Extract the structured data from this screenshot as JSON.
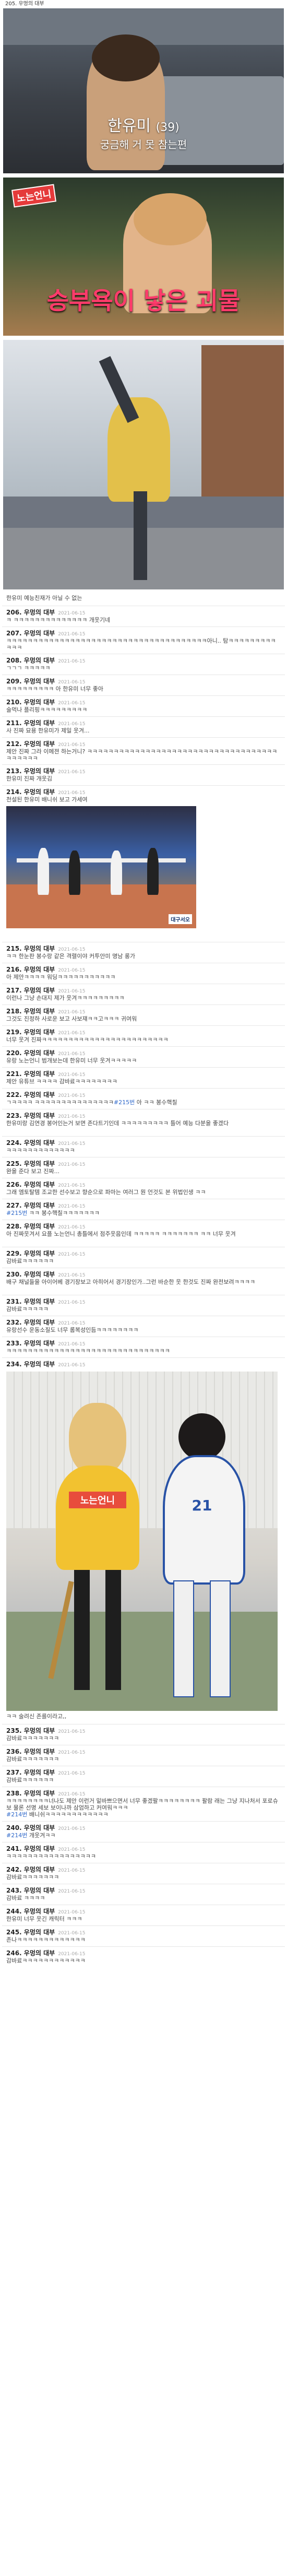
{
  "intro": "205. 우멍의 대부",
  "photo1": {
    "name": "한유미",
    "age": "(39)",
    "subtitle": "궁금해 거 못 참는편"
  },
  "photo2": {
    "logo": "노는언니",
    "caption": "승부욕이 낳은 괴물"
  },
  "under_text": "한유미 예능친재가 아닐 수 없는",
  "comments_a": [
    {
      "num": "206.",
      "author": "우멍의 대부",
      "date": "2021-06-15",
      "text": "ㅋ ㅋㅋㅋㅋㅋㅋㅋㅋㅋㅋㅋㅋㅋㅋ 개웃기네"
    },
    {
      "num": "207.",
      "author": "우멍의 대부",
      "date": "2021-06-15",
      "text": "ㅋㅋㅋㅋㅋㅋㅋㅋㅋㅋㅋㅋㅋㅋㅋㅋㅋㅋㅋㅋㅋㅋㅋㅋㅋㅋㅋㅋㅋㅋㅋㅋㅋㅋㅋㅋㅋㅋ아니.. 탐ㅋㅋㅋㅋㅋㅋㅋㅋㅋㅋㅋㅋ"
    },
    {
      "num": "208.",
      "author": "우멍의 대부",
      "date": "2021-06-15",
      "text": "ㄱㄱㄱ ㅋㅋㅋㅋㅋ"
    },
    {
      "num": "209.",
      "author": "우멍의 대부",
      "date": "2021-06-15",
      "text": "ㅋㅋㅋㅋㅋㅋㅋㅋㅋ 아 한유미 너무 좋아"
    },
    {
      "num": "210.",
      "author": "우멍의 대부",
      "date": "2021-06-15",
      "text": "술먹나 플리핑ㅋㅋㅋㅋㅋㅋㅋㅋㅋ"
    },
    {
      "num": "211.",
      "author": "우멍의 대부",
      "date": "2021-06-15",
      "text": "사 진짜 묘용 한유미가 제일 웃겨..."
    },
    {
      "num": "212.",
      "author": "우멍의 대부",
      "date": "2021-06-15",
      "text": "제안 진짜 그라 이메젼 하는거니? ㅋㅋㅋㅋㅋㅋㅋㅋㅋㅋㅋㅋㅋㅋㅋㅋㅋㅋㅋㅋㅋㅋㅋㅋㅋㅋㅋㅋㅋㅋㅋㅋㅋㅋㅋㅋㅋㅋㅋㅋㅋㅋ"
    },
    {
      "num": "213.",
      "author": "우멍의 대부",
      "date": "2021-06-15",
      "text": "한유미 진짜 개웃김"
    }
  ],
  "comment_214": {
    "num": "214.",
    "author": "우멍의 대부",
    "date": "2021-06-15",
    "text": "천설된 한유미 배니쉬 보고 가세여"
  },
  "photo4": {
    "banner": "대구서오"
  },
  "comments_b": [
    {
      "num": "215.",
      "author": "우멍의 대부",
      "date": "2021-06-15",
      "text": "ㅋㅋ 한눈판 봉수랑 같은 격렬이야 커투안미 명남 롱가"
    },
    {
      "num": "216.",
      "author": "우멍의 대부",
      "date": "2021-06-15",
      "text": "아 제안ㅋㅋㅋㅋ 워딩ㅋㅋㅋㅋㅋㅋㅋㅋㅋㅋㅋ"
    },
    {
      "num": "217.",
      "author": "우멍의 대부",
      "date": "2021-06-15",
      "text": "이런나 그냥 손대지 제가 웃겨ㅋㅋㅋㅋㅋㅋㅋㅋㅋ"
    },
    {
      "num": "218.",
      "author": "우멍의 대부",
      "date": "2021-06-15",
      "text": "그것도 진정하 사로운 보고 사보쟤ㅋㅋ고ㅋㅋㅋ 귀여워"
    },
    {
      "num": "219.",
      "author": "우멍의 대부",
      "date": "2021-06-15",
      "text": "너무 웃겨 진짜ㅋㅋㅋㅋㅋㅋㅋㅋㅋㅋㅋㅋㅋㅋㅋㅋㅋㅋㅋㅋㅋㅋㅋㅋ"
    },
    {
      "num": "220.",
      "author": "우멍의 대부",
      "date": "2021-06-15",
      "text": "유랑 노는언니 범개보는데 한유미 너무 웃겨ㅋㅋㅋㅋㅋ"
    },
    {
      "num": "221.",
      "author": "우멍의 대부",
      "date": "2021-06-15",
      "text": "제안 유튜브 ㅋㅋㅋㅋ 감바료ㅋㅋㅋㅋㅋㅋㅋㅋ"
    }
  ],
  "comment_222": {
    "num": "222.",
    "author": "우멍의 대부",
    "date": "2021-06-15",
    "prefix": "ㄱㅋㅋㅋㅋ ㅋㅋㅋㅋㅋㅋㅋㅋㅋㅋㅋㅋㅋㅋㅋ",
    "link": "#215번",
    "suffix": " 아 ㅋㅋ 봉수핵칠"
  },
  "comment_223": {
    "num": "223.",
    "author": "우멍의 대부",
    "date": "2021-06-15",
    "text": "한유미랑 김연경 봉어인는거 보면 존다트기인데 ㅋㅋㅋㅋㅋㅋㅋㅋㅋ 틀어 예능 다분을 좋겠다"
  },
  "comments_c": [
    {
      "num": "224.",
      "author": "우멍의 대부",
      "date": "2021-06-15",
      "text": "ㅋㅋㅋㅋㅋㅋㅋㅋㅋㅋㅋㅋㅋ"
    },
    {
      "num": "225.",
      "author": "우멍의 대부",
      "date": "2021-06-15",
      "text": "완을 준다 보고 진짜..."
    },
    {
      "num": "226.",
      "author": "우멍의 대부",
      "date": "2021-06-15",
      "text": "그래 엠토탈템 조교한 선수보고 향순으로 파마는 여러그 뭔 언것도 본 위법인생 ㅋㅋ"
    }
  ],
  "comment_227": {
    "num": "227.",
    "author": "우멍의 대부",
    "date": "2021-06-15",
    "link": "#215번",
    "suffix": " ㅋㅋ 봉수핵칠ㅋㅋㅋㅋㅋㅋㅋ"
  },
  "comment_228": {
    "num": "228.",
    "author": "우멍의 대부",
    "date": "2021-06-15",
    "text": "아 진짜웃겨서 요플 노는언니 총틀에서 점주웃음인데 ㅋㅋㅋㅋㅋ ㅋㅋㅋㅋㅋㅋㅋ ㅋㅋ 너무 웃겨"
  },
  "comments_d": [
    {
      "num": "229.",
      "author": "우멍의 대부",
      "date": "2021-06-15",
      "text": "감바료ㅋㅋㅋㅋㅋㅋ"
    }
  ],
  "comment_230": {
    "num": "230.",
    "author": "우멍의 대부",
    "date": "2021-06-15",
    "text": "배구 채널들을 아이어베 경기장보고 아히어서 경기장인가..그런 바순한 웃 한것도 진짜 완전보려ㅋㅋㅋㅋ"
  },
  "comments_e": [
    {
      "num": "231.",
      "author": "우멍의 대부",
      "date": "2021-06-15",
      "text": "감바료ㅋㅋㅋㅋㅋ"
    },
    {
      "num": "232.",
      "author": "우멍의 대부",
      "date": "2021-06-15",
      "text": "유랑선수 운동소질도 너무 롬복성인듬ㅋㅋㅋㅋㅋㅋㅋㅋ"
    },
    {
      "num": "233.",
      "author": "우멍의 대부",
      "date": "2021-06-15",
      "text": "ㅋㅋㅋㅋㅋㅋㅋㅋㅋㅋㅋㅋㅋㅋㅋㅋㅋㅋㅋㅋㅋㅋㅋㅋㅋㅋㅋㅋㅋㅋㅋ"
    }
  ],
  "comment_234": {
    "num": "234.",
    "author": "우멍의 대부",
    "date": "2021-06-15"
  },
  "photo5": {
    "shirt_text": "노는언니",
    "jersey_num": "21"
  },
  "photo5_caption": "ㅋㅋ 술려신 존를이라고,,",
  "comments_f": [
    {
      "num": "235.",
      "author": "우멍의 대부",
      "date": "2021-06-15",
      "text": "감바료ㅋㅋㅋㅋㅋㅋㅋ"
    },
    {
      "num": "236.",
      "author": "우멍의 대부",
      "date": "2021-06-15",
      "text": "감바료ㅋㅋㅋㅋㅋㅋㅋ"
    },
    {
      "num": "237.",
      "author": "우멍의 대부",
      "date": "2021-06-15",
      "text": "감바료ㅋㅋㅋㅋㅋㅋ"
    }
  ],
  "comment_238": {
    "num": "238.",
    "author": "우멍의 대부",
    "date": "2021-06-15",
    "text": "ㅋㅋㅋㅋㅋㅋㅋㅋ너나도 제안 이런거 밑바쁘으면서 너무 좋겠팔ㅋㅋㅋㅋㅋㅋㅋㅋ 팔람 래는 그냥 지나처서 포로슈보 물론 선명 세보 보이나까 삼엄하고 커여워ㅋㅋㅋ",
    "link": "#214번",
    "suffix": " 배니쉬ㅋㅋㅋㅋㅋㅋㅋㅋㅋㅋㅋㅋ"
  },
  "comment_240": {
    "num": "240.",
    "author": "우멍의 대부",
    "date": "2021-06-15",
    "link": "#214번",
    "suffix": " 개웃겨ㅋㅋ"
  },
  "comments_g": [
    {
      "num": "241.",
      "author": "우멍의 대부",
      "date": "2021-06-15",
      "text": "ㅋㅋㅋㅋㅋㅋㅋㅋㅋㅋㅋㅋㅋㅋㅋㅋㅋ"
    },
    {
      "num": "242.",
      "author": "우멍의 대부",
      "date": "2021-06-15",
      "text": "감바료ㅋㅋㅋㅋㅋㅋㅋ"
    },
    {
      "num": "243.",
      "author": "우멍의 대부",
      "date": "2021-06-15",
      "text": "감바료 ㅋㅋㅋㅋ"
    },
    {
      "num": "244.",
      "author": "우멍의 대부",
      "date": "2021-06-15",
      "text": "한유미 너무 웃긴 캐릭터 ㅋㅋㅋ"
    },
    {
      "num": "245.",
      "author": "우멍의 대부",
      "date": "2021-06-15",
      "text": "존나ㅋㅋㅋㅋㅋㅋㅋㅋㅋㅋㅋㅋㅋ"
    },
    {
      "num": "246.",
      "author": "우멍의 대부",
      "date": "2021-06-15",
      "text": "감바료ㅋㅋㅋㅋㅋㅋㅋㅋㅋㅋㅋㅋ"
    }
  ]
}
